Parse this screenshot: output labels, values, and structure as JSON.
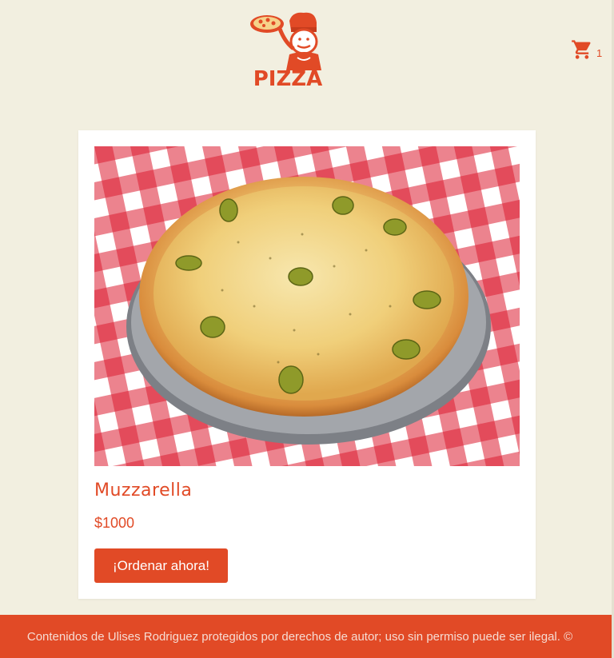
{
  "header": {
    "logo_text": "PIZZA",
    "cart_icon": "shopping-cart-icon",
    "cart_count": "1"
  },
  "product": {
    "name": "Muzzarella",
    "price": "$1000",
    "order_label": "¡Ordenar ahora!",
    "image_icon": "pizza-photo"
  },
  "footer": {
    "text": "Contenidos de Ulises Rodriguez protegidos por derechos de autor; uso sin permiso puede ser ilegal. ©"
  },
  "colors": {
    "accent": "#e14a26",
    "background": "#f2efe0",
    "card": "#ffffff"
  }
}
